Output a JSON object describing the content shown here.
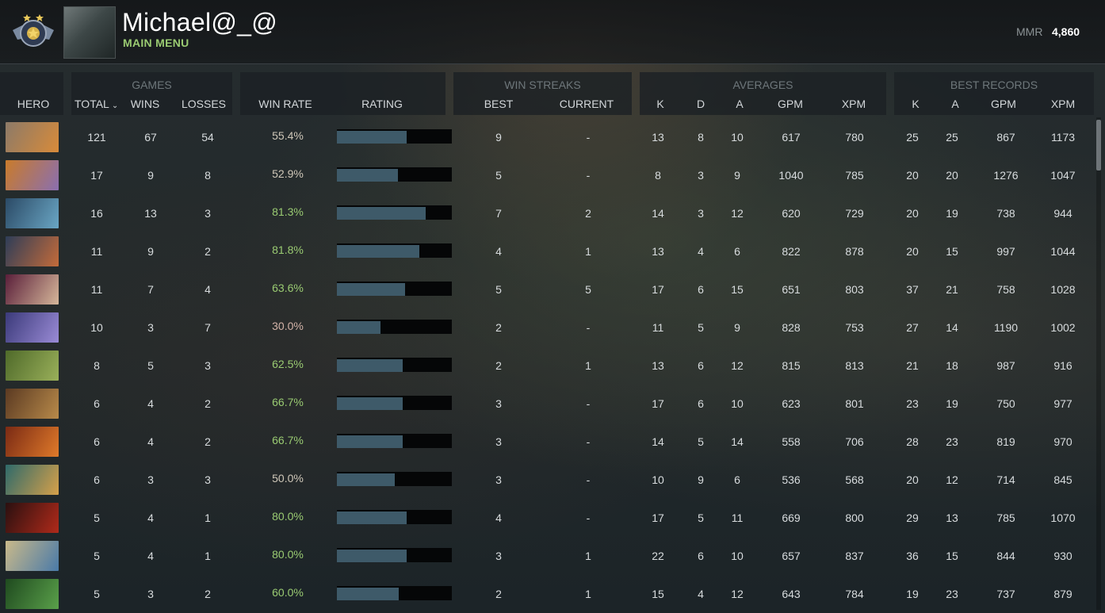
{
  "header": {
    "player_name": "Michael@_@",
    "menu_label": "MAIN MENU",
    "mmr_label": "MMR",
    "mmr_value": "4,860"
  },
  "groups": {
    "games": "GAMES",
    "win_streaks": "WIN STREAKS",
    "averages": "AVERAGES",
    "best_records": "BEST RECORDS"
  },
  "columns": {
    "hero": "HERO",
    "total": "TOTAL",
    "wins": "WINS",
    "losses": "LOSSES",
    "win_rate": "WIN RATE",
    "rating": "RATING",
    "best": "BEST",
    "current": "CURRENT",
    "avg_k": "K",
    "avg_d": "D",
    "avg_a": "A",
    "avg_gpm": "GPM",
    "avg_xpm": "XPM",
    "rec_k": "K",
    "rec_a": "A",
    "rec_gpm": "GPM",
    "rec_xpm": "XPM"
  },
  "colors": {
    "win_rate_green": "#9acb72",
    "win_rate_neutral": "#cfc7b8",
    "win_rate_red": "#d3b3a8",
    "bar_fill": "#3e5a69",
    "menu_green": "#9acb72"
  },
  "rows": [
    {
      "portrait": [
        "#8c7a68",
        "#d88b3a"
      ],
      "total": "121",
      "wins": "67",
      "losses": "54",
      "win_rate": "55.4%",
      "rating": 0.61,
      "best": "9",
      "current": "-",
      "k": "13",
      "d": "8",
      "a": "10",
      "gpm": "617",
      "xpm": "780",
      "rk": "25",
      "ra": "25",
      "rgpm": "867",
      "rxpm": "1173"
    },
    {
      "portrait": [
        "#c97b2b",
        "#8a6fb0"
      ],
      "total": "17",
      "wins": "9",
      "losses": "8",
      "win_rate": "52.9%",
      "rating": 0.53,
      "best": "5",
      "current": "-",
      "k": "8",
      "d": "3",
      "a": "9",
      "gpm": "1040",
      "xpm": "785",
      "rk": "20",
      "ra": "20",
      "rgpm": "1276",
      "rxpm": "1047"
    },
    {
      "portrait": [
        "#2b4a66",
        "#6aa6c4"
      ],
      "total": "16",
      "wins": "13",
      "losses": "3",
      "win_rate": "81.3%",
      "rating": 0.77,
      "best": "7",
      "current": "2",
      "k": "14",
      "d": "3",
      "a": "12",
      "gpm": "620",
      "xpm": "729",
      "rk": "20",
      "ra": "19",
      "rgpm": "738",
      "rxpm": "944"
    },
    {
      "portrait": [
        "#2e3d58",
        "#c46b3a"
      ],
      "total": "11",
      "wins": "9",
      "losses": "2",
      "win_rate": "81.8%",
      "rating": 0.72,
      "best": "4",
      "current": "1",
      "k": "13",
      "d": "4",
      "a": "6",
      "gpm": "822",
      "xpm": "878",
      "rk": "20",
      "ra": "15",
      "rgpm": "997",
      "rxpm": "1044"
    },
    {
      "portrait": [
        "#5a1f3a",
        "#d6b79a"
      ],
      "total": "11",
      "wins": "7",
      "losses": "4",
      "win_rate": "63.6%",
      "rating": 0.59,
      "best": "5",
      "current": "5",
      "k": "17",
      "d": "6",
      "a": "15",
      "gpm": "651",
      "xpm": "803",
      "rk": "37",
      "ra": "21",
      "rgpm": "758",
      "rxpm": "1028"
    },
    {
      "portrait": [
        "#3b3a7a",
        "#9a8bd6"
      ],
      "total": "10",
      "wins": "3",
      "losses": "7",
      "win_rate": "30.0%",
      "rating": 0.38,
      "best": "2",
      "current": "-",
      "k": "11",
      "d": "5",
      "a": "9",
      "gpm": "828",
      "xpm": "753",
      "rk": "27",
      "ra": "14",
      "rgpm": "1190",
      "rxpm": "1002"
    },
    {
      "portrait": [
        "#4f6a2a",
        "#9ab05a"
      ],
      "total": "8",
      "wins": "5",
      "losses": "3",
      "win_rate": "62.5%",
      "rating": 0.57,
      "best": "2",
      "current": "1",
      "k": "13",
      "d": "6",
      "a": "12",
      "gpm": "815",
      "xpm": "813",
      "rk": "21",
      "ra": "18",
      "rgpm": "987",
      "rxpm": "916"
    },
    {
      "portrait": [
        "#5b3a22",
        "#b88a4a"
      ],
      "total": "6",
      "wins": "4",
      "losses": "2",
      "win_rate": "66.7%",
      "rating": 0.57,
      "best": "3",
      "current": "-",
      "k": "17",
      "d": "6",
      "a": "10",
      "gpm": "623",
      "xpm": "801",
      "rk": "23",
      "ra": "19",
      "rgpm": "750",
      "rxpm": "977"
    },
    {
      "portrait": [
        "#7a2a14",
        "#e07a2a"
      ],
      "total": "6",
      "wins": "4",
      "losses": "2",
      "win_rate": "66.7%",
      "rating": 0.57,
      "best": "3",
      "current": "-",
      "k": "14",
      "d": "5",
      "a": "14",
      "gpm": "558",
      "xpm": "706",
      "rk": "28",
      "ra": "23",
      "rgpm": "819",
      "rxpm": "970"
    },
    {
      "portrait": [
        "#2f6a6a",
        "#d6a04a"
      ],
      "total": "6",
      "wins": "3",
      "losses": "3",
      "win_rate": "50.0%",
      "rating": 0.5,
      "best": "3",
      "current": "-",
      "k": "10",
      "d": "9",
      "a": "6",
      "gpm": "536",
      "xpm": "568",
      "rk": "20",
      "ra": "12",
      "rgpm": "714",
      "rxpm": "845"
    },
    {
      "portrait": [
        "#2a1010",
        "#b02a1a"
      ],
      "total": "5",
      "wins": "4",
      "losses": "1",
      "win_rate": "80.0%",
      "rating": 0.61,
      "best": "4",
      "current": "-",
      "k": "17",
      "d": "5",
      "a": "11",
      "gpm": "669",
      "xpm": "800",
      "rk": "29",
      "ra": "13",
      "rgpm": "785",
      "rxpm": "1070"
    },
    {
      "portrait": [
        "#c9b98a",
        "#4a7aa8"
      ],
      "total": "5",
      "wins": "4",
      "losses": "1",
      "win_rate": "80.0%",
      "rating": 0.61,
      "best": "3",
      "current": "1",
      "k": "22",
      "d": "6",
      "a": "10",
      "gpm": "657",
      "xpm": "837",
      "rk": "36",
      "ra": "15",
      "rgpm": "844",
      "rxpm": "930"
    },
    {
      "portrait": [
        "#1f4a1f",
        "#5aa04a"
      ],
      "total": "5",
      "wins": "3",
      "losses": "2",
      "win_rate": "60.0%",
      "rating": 0.54,
      "best": "2",
      "current": "1",
      "k": "15",
      "d": "4",
      "a": "12",
      "gpm": "643",
      "xpm": "784",
      "rk": "19",
      "ra": "23",
      "rgpm": "737",
      "rxpm": "879"
    }
  ]
}
